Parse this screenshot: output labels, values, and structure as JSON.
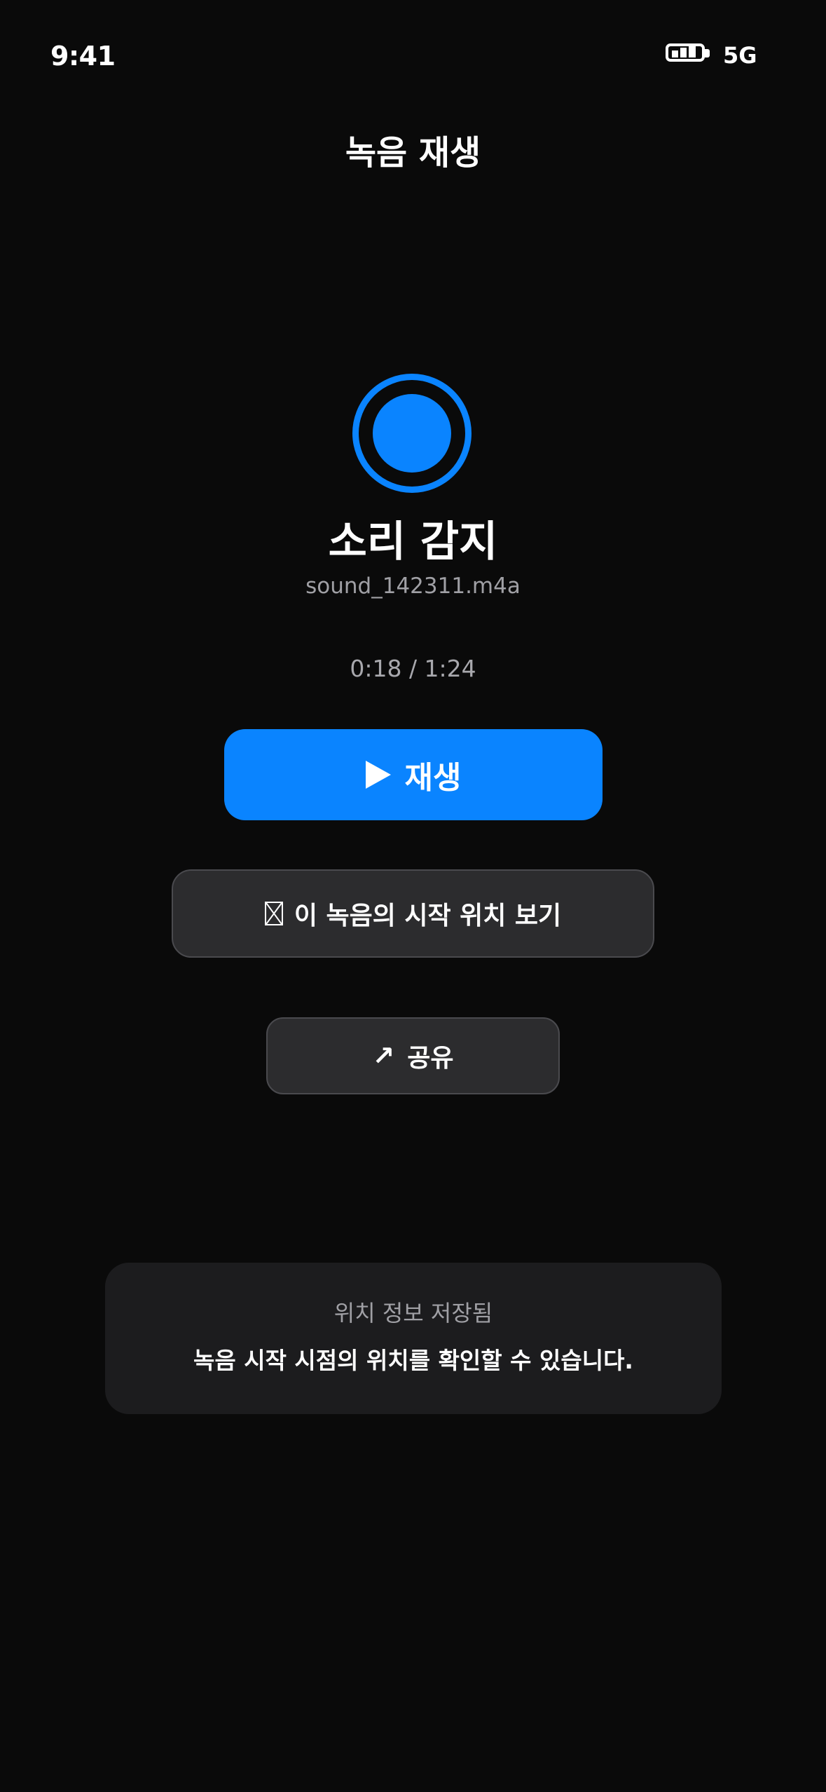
{
  "status_bar": {
    "time": "9:41",
    "network": "5G",
    "battery_icon": "battery-icon"
  },
  "header": {
    "title": "녹음 재생"
  },
  "recording": {
    "icon": "record-icon",
    "title": "소리 감지",
    "file_name": "sound_142311.m4a",
    "time_display": "0:18 / 1:24"
  },
  "actions": {
    "play": {
      "icon": "play-icon",
      "label": "재생"
    },
    "location": {
      "icon": "map-icon",
      "label": "이 녹음의 시작 위치 보기"
    },
    "share": {
      "icon": "share-icon",
      "glyph": "↗",
      "label": "공유"
    }
  },
  "info_card": {
    "title": "위치 정보 저장됨",
    "body": "녹음 시작 시점의 위치를 확인할 수 있습니다."
  },
  "colors": {
    "background": "#0a0a0a",
    "accent": "#0a84ff",
    "button_secondary": "#2c2c2e",
    "card": "#1c1c1e",
    "muted_text": "#a0a0a5"
  }
}
